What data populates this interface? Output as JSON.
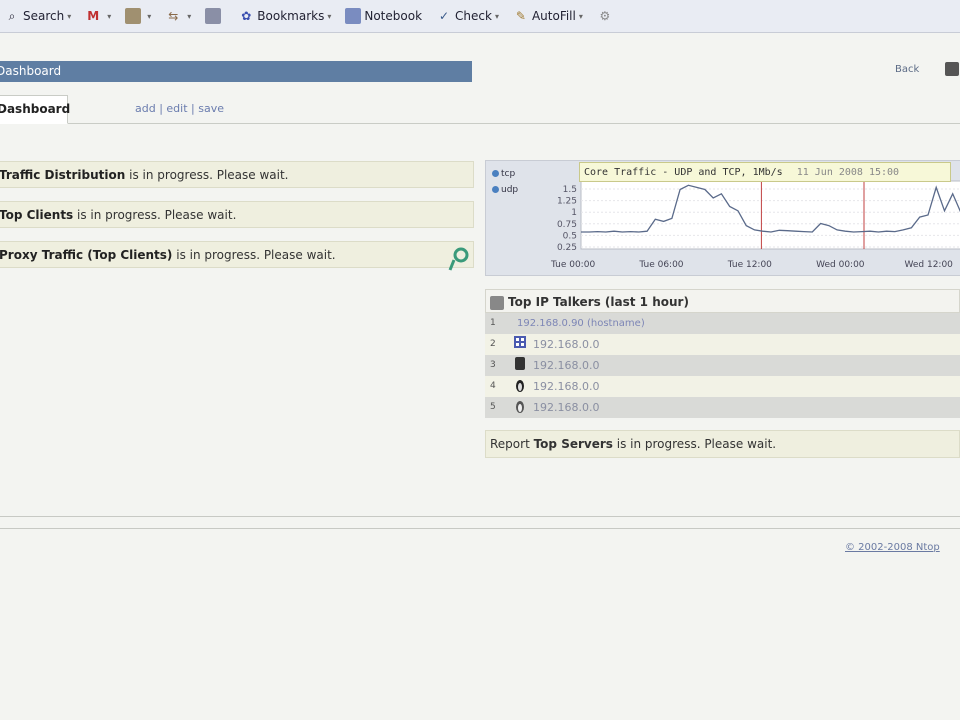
{
  "toolbar": {
    "items": [
      {
        "label": "Search",
        "icon": "search-icon"
      },
      {
        "label": "",
        "icon": "mail-icon"
      },
      {
        "label": "",
        "icon": "grid-icon"
      },
      {
        "label": "",
        "icon": "share-icon"
      },
      {
        "label": "",
        "icon": "folder-icon"
      },
      {
        "label": "Bookmarks",
        "icon": "bookmark-star-icon"
      },
      {
        "label": "Notebook",
        "icon": "notebook-icon"
      },
      {
        "label": "Check",
        "icon": "check-icon"
      },
      {
        "label": "AutoFill",
        "icon": "autofill-icon"
      }
    ]
  },
  "header": {
    "title": "Dashboard",
    "back_label": "Back"
  },
  "tabs": {
    "active": "Dashboard",
    "links": "add | edit | save"
  },
  "left_reports": [
    {
      "name": "Traffic Distribution",
      "suffix": " is in progress. Please wait."
    },
    {
      "name": "Top Clients",
      "suffix": " is in progress. Please wait."
    },
    {
      "name": "Proxy Traffic (Top Clients)",
      "suffix": " is in progress. Please wait."
    }
  ],
  "chart_data": {
    "type": "line",
    "title": "Core Traffic - UDP and TCP, 1Mb/s",
    "date_label": "11 Jun 2008 15:00",
    "legend": [
      "tcp",
      "udp"
    ],
    "yticks": [
      "1.5",
      "1.25",
      "1",
      "0.75",
      "0.5",
      "0.25"
    ],
    "xticks": [
      "Tue 00:00",
      "Tue 06:00",
      "Tue 12:00",
      "Wed 00:00",
      "Wed 12:00"
    ],
    "series": [
      {
        "name": "tcp",
        "values": [
          0.4,
          0.4,
          0.41,
          0.4,
          0.42,
          0.4,
          0.41,
          0.4,
          0.42,
          0.7,
          0.65,
          0.72,
          1.4,
          1.5,
          1.45,
          1.4,
          1.2,
          1.3,
          1.0,
          0.9,
          0.55,
          0.45,
          0.42,
          0.4,
          0.44,
          0.43,
          0.42,
          0.41,
          0.4,
          0.6,
          0.55,
          0.45,
          0.42,
          0.4,
          0.41,
          0.42,
          0.4,
          0.42,
          0.41,
          0.45,
          0.5,
          0.75,
          0.8,
          1.45,
          0.9,
          1.3,
          0.85
        ]
      }
    ],
    "colors": {
      "tcp": "#5a6a8a",
      "udp": "#4a80c0",
      "marker": "#c04040"
    }
  },
  "top_talkers": {
    "title": "Top IP Talkers (last 1 hour)",
    "rows": [
      {
        "idx": "1",
        "ip": "192.168.0.90 (hostname)",
        "icon": ""
      },
      {
        "idx": "2",
        "ip": "192.168.0.0",
        "icon": "windows-os-icon"
      },
      {
        "idx": "3",
        "ip": "192.168.0.0",
        "icon": "apple-os-icon"
      },
      {
        "idx": "4",
        "ip": "192.168.0.0",
        "icon": "linux-penguin-icon"
      },
      {
        "idx": "5",
        "ip": "192.168.0.0",
        "icon": "linux-penguin-icon"
      }
    ]
  },
  "report_bottom": {
    "prefix": "Report ",
    "name": "Top Servers",
    "suffix": " is in progress. Please wait."
  },
  "footer": {
    "copyright": "© 2002-2008 Ntop"
  }
}
